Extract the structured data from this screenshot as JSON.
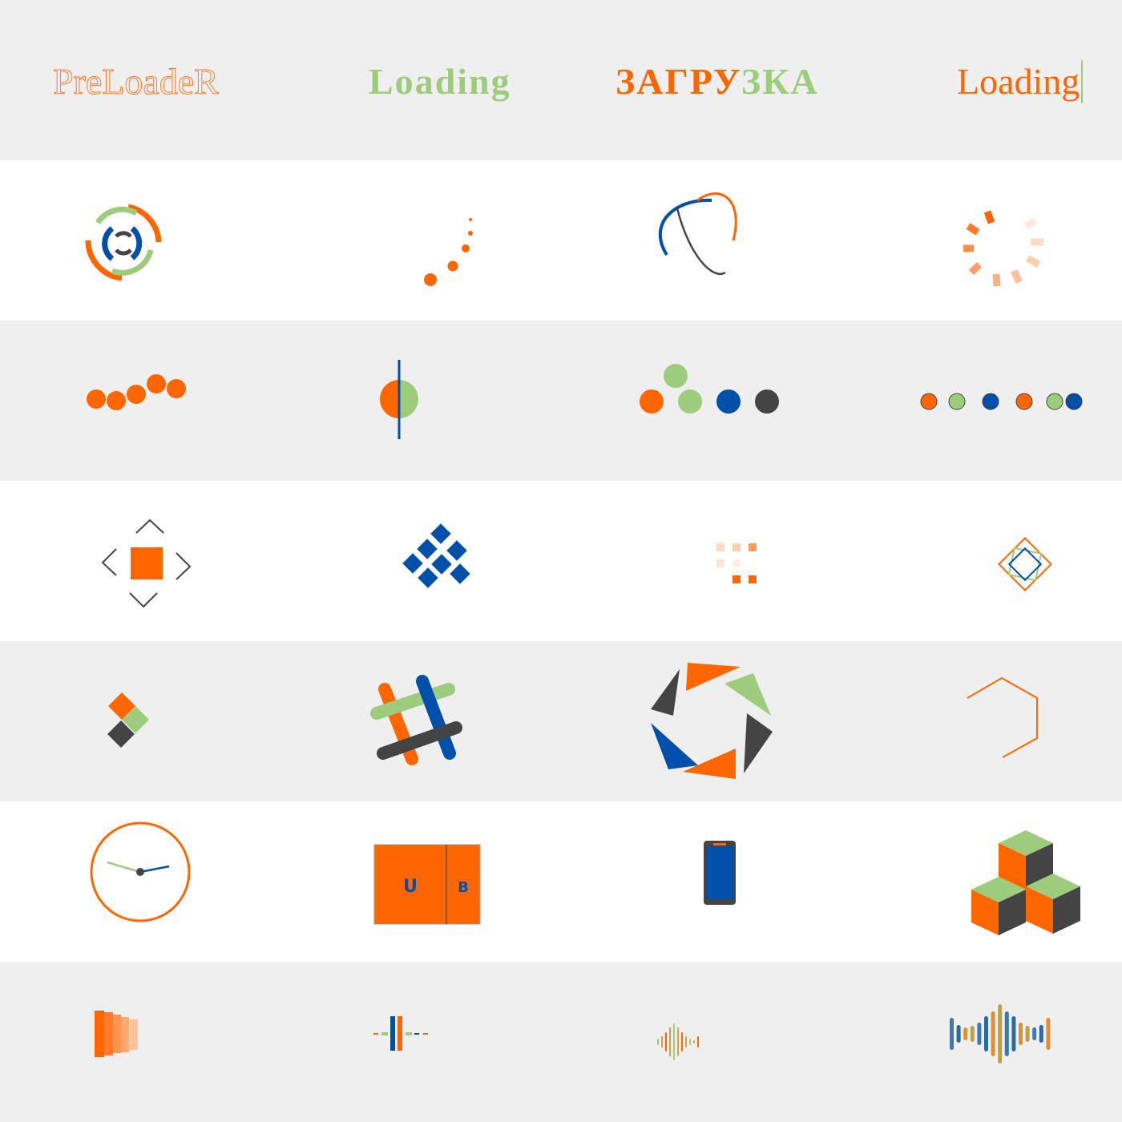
{
  "titles": {
    "t1": "PreLoadeR",
    "t2a": "Lo",
    "t2b": "ading",
    "t3a": "ЗАГРУ",
    "t3b": "ЗКА",
    "t4": "Loading"
  },
  "phone_box_letters": {
    "left": "U",
    "right": "B"
  },
  "colors": {
    "orange": "#ff6600",
    "green": "#9ccc7c",
    "blue": "#0050aa",
    "dark": "#444444",
    "background": "#efefef"
  }
}
